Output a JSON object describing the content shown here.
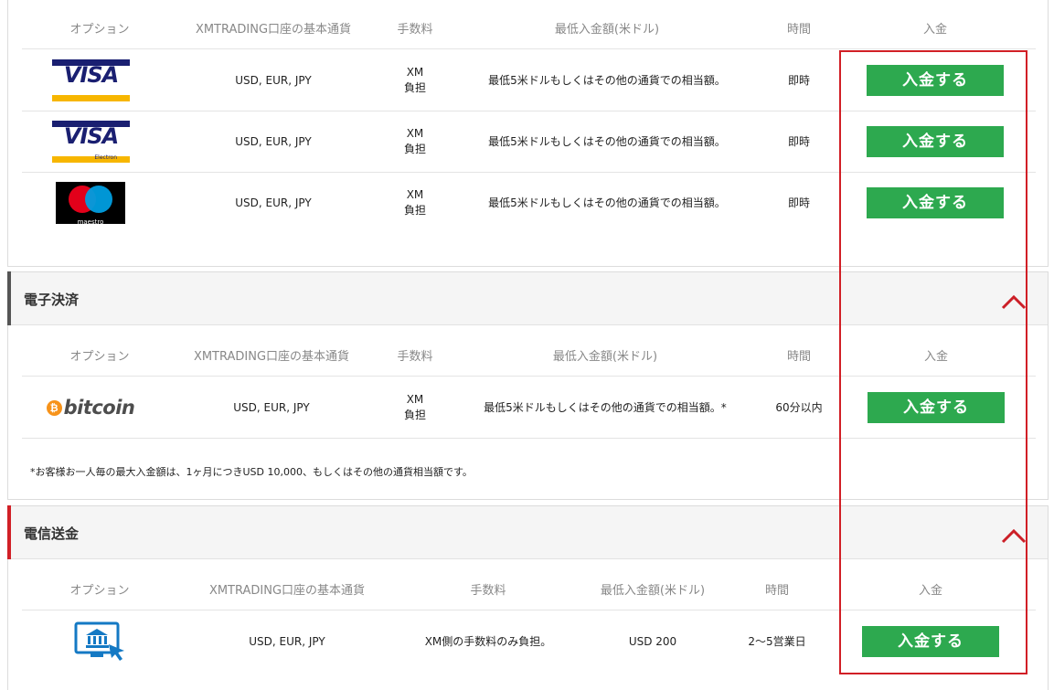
{
  "colors": {
    "deposit_button": "#2da94f",
    "highlight_border": "#d11f26",
    "chevron": "#cc1f27",
    "ewallet_accent": "#555555",
    "wire_accent": "#d11f26"
  },
  "cards": {
    "headers": {
      "option": "オプション",
      "base_currency": "XMTRADING口座の基本通貨",
      "fee": "手数料",
      "minimum": "最低入金額(米ドル)",
      "time": "時間",
      "deposit": "入金"
    },
    "rows": [
      {
        "logo": "visa-logo",
        "logo_text": "VISA",
        "currency": "USD, EUR, JPY",
        "fee_line1": "XM",
        "fee_line2": "負担",
        "minimum": "最低5米ドルもしくはその他の通貨での相当額。",
        "time": "即時",
        "button": "入金する"
      },
      {
        "logo": "visa-electron-logo",
        "logo_text": "VISA",
        "logo_sub": "Electron",
        "currency": "USD, EUR, JPY",
        "fee_line1": "XM",
        "fee_line2": "負担",
        "minimum": "最低5米ドルもしくはその他の通貨での相当額。",
        "time": "即時",
        "button": "入金する"
      },
      {
        "logo": "maestro-logo",
        "logo_text": "maestro",
        "currency": "USD, EUR, JPY",
        "fee_line1": "XM",
        "fee_line2": "負担",
        "minimum": "最低5米ドルもしくはその他の通貨での相当額。",
        "time": "即時",
        "button": "入金する"
      }
    ]
  },
  "ewallet": {
    "title": "電子決済",
    "headers": {
      "option": "オプション",
      "base_currency": "XMTRADING口座の基本通貨",
      "fee": "手数料",
      "minimum": "最低入金額(米ドル)",
      "time": "時間",
      "deposit": "入金"
    },
    "rows": [
      {
        "logo": "bitcoin-logo",
        "logo_symbol": "₿",
        "logo_text": "bitcoin",
        "currency": "USD, EUR, JPY",
        "fee_line1": "XM",
        "fee_line2": "負担",
        "minimum": "最低5米ドルもしくはその他の通貨での相当額。*",
        "time": "60分以内",
        "button": "入金する"
      }
    ],
    "note": "*お客様お一人毎の最大入金額は、1ヶ月につきUSD 10,000、もしくはその他の通貨相当額です。"
  },
  "wire": {
    "title": "電信送金",
    "headers": {
      "option": "オプション",
      "base_currency": "XMTRADING口座の基本通貨",
      "fee": "手数料",
      "minimum": "最低入金額(米ドル)",
      "time": "時間",
      "deposit": "入金"
    },
    "rows": [
      {
        "logo": "bank-transfer-icon",
        "currency": "USD, EUR, JPY",
        "fee": "XM側の手数料のみ負担。",
        "minimum": "USD 200",
        "time": "2～5営業日",
        "button": "入金する"
      }
    ]
  }
}
